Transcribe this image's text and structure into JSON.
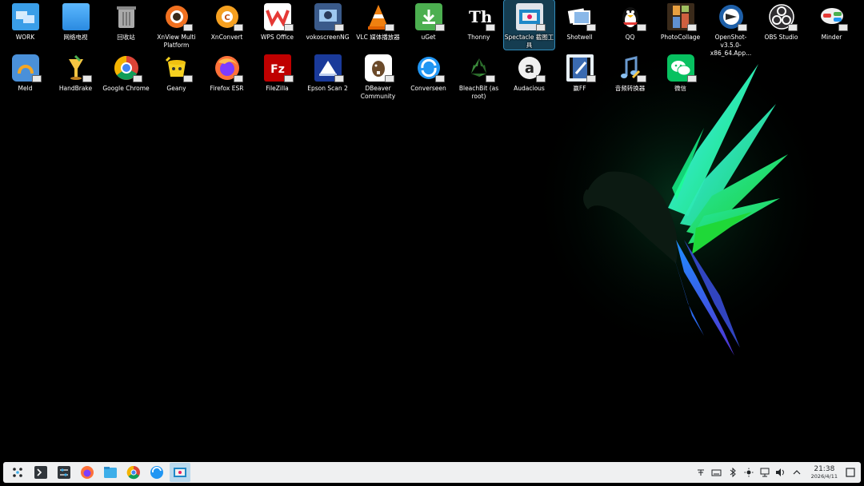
{
  "desktop": {
    "row1": [
      {
        "label": "WORK",
        "icon": "folder-work-icon"
      },
      {
        "label": "网络电视",
        "icon": "folder-icon"
      },
      {
        "label": "回收站",
        "icon": "trash-icon"
      },
      {
        "label": "XnView Multi Platform",
        "icon": "xnview-icon"
      },
      {
        "label": "XnConvert",
        "icon": "xnconvert-icon"
      },
      {
        "label": "WPS Office",
        "icon": "wps-icon"
      },
      {
        "label": "vokoscreenNG",
        "icon": "vokoscreen-icon"
      },
      {
        "label": "VLC 媒体播放器",
        "icon": "vlc-icon"
      },
      {
        "label": "uGet",
        "icon": "uget-icon"
      },
      {
        "label": "Thonny",
        "icon": "thonny-icon"
      },
      {
        "label": "Spectacle 截图工具",
        "icon": "spectacle-icon"
      },
      {
        "label": "Shotwell",
        "icon": "shotwell-icon"
      },
      {
        "label": "QQ",
        "icon": "qq-penguin-icon"
      },
      {
        "label": "PhotoCollage",
        "icon": "photocollage-icon"
      },
      {
        "label": "OpenShot-v3.5.0-x86_64.App...",
        "icon": "openshot-icon"
      },
      {
        "label": "OBS Studio",
        "icon": "obs-icon"
      },
      {
        "label": "Minder",
        "icon": "minder-icon"
      }
    ],
    "row2": [
      {
        "label": "Meld",
        "icon": "meld-icon"
      },
      {
        "label": "HandBrake",
        "icon": "handbrake-icon"
      },
      {
        "label": "Google Chrome",
        "icon": "chrome-icon"
      },
      {
        "label": "Geany",
        "icon": "geany-icon"
      },
      {
        "label": "Firefox ESR",
        "icon": "firefox-icon"
      },
      {
        "label": "FileZilla",
        "icon": "filezilla-icon"
      },
      {
        "label": "Epson Scan 2",
        "icon": "epson-scan-icon"
      },
      {
        "label": "DBeaver Community",
        "icon": "dbeaver-icon"
      },
      {
        "label": "Converseen",
        "icon": "converseen-icon"
      },
      {
        "label": "BleachBit (as root)",
        "icon": "bleachbit-icon"
      },
      {
        "label": "Audacious",
        "icon": "audacious-icon"
      },
      {
        "label": "赢FF",
        "icon": "winff-icon"
      },
      {
        "label": "音频转换器",
        "icon": "audio-converter-icon"
      },
      {
        "label": "微信",
        "icon": "wechat-icon"
      }
    ],
    "selected": "Spectacle 截图工具"
  },
  "taskbar": {
    "launchers": [
      "app-launcher-icon",
      "terminal-icon",
      "settings-icon",
      "firefox-icon",
      "file-manager-icon",
      "chrome-icon",
      "converseen-icon",
      "spectacle-icon"
    ],
    "tray": [
      "clipboard-icon",
      "keyboard-icon",
      "bluetooth-icon",
      "brightness-icon",
      "network-icon",
      "volume-icon",
      "expand-tray-icon"
    ],
    "clock": {
      "time": "21:38",
      "date": "2026/4/11"
    },
    "show_desktop": "show-desktop-icon"
  },
  "colors": {
    "taskbar_bg": "#eff0f1",
    "selection": "#3daee9",
    "wallpaper_bg": "#000000"
  }
}
